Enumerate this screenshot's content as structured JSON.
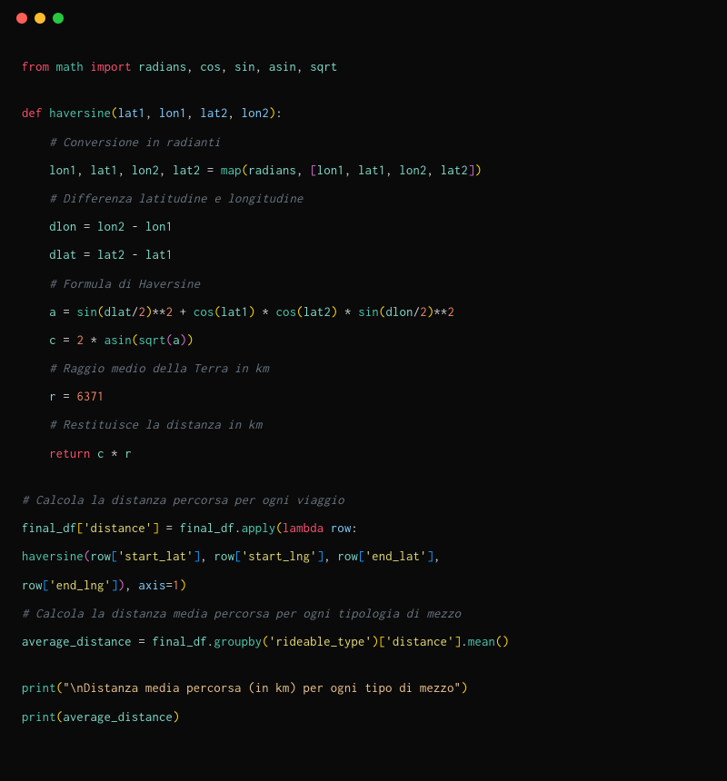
{
  "code": {
    "lines": [
      {
        "type": "code",
        "tokens": [
          {
            "cls": "kw-red",
            "t": "from"
          },
          {
            "cls": "white",
            "t": " "
          },
          {
            "cls": "fn-teal",
            "t": "math"
          },
          {
            "cls": "white",
            "t": " "
          },
          {
            "cls": "kw-red",
            "t": "import"
          },
          {
            "cls": "white",
            "t": " "
          },
          {
            "cls": "var-blue",
            "t": "radians"
          },
          {
            "cls": "punct",
            "t": ", "
          },
          {
            "cls": "var-blue",
            "t": "cos"
          },
          {
            "cls": "punct",
            "t": ", "
          },
          {
            "cls": "var-blue",
            "t": "sin"
          },
          {
            "cls": "punct",
            "t": ", "
          },
          {
            "cls": "var-blue",
            "t": "asin"
          },
          {
            "cls": "punct",
            "t": ", "
          },
          {
            "cls": "var-blue",
            "t": "sqrt"
          }
        ]
      },
      {
        "type": "blank"
      },
      {
        "type": "code",
        "tokens": [
          {
            "cls": "kw-red",
            "t": "def"
          },
          {
            "cls": "white",
            "t": " "
          },
          {
            "cls": "fn-teal",
            "t": "haversine"
          },
          {
            "cls": "paren",
            "t": "("
          },
          {
            "cls": "var-cyan",
            "t": "lat1"
          },
          {
            "cls": "punct",
            "t": ", "
          },
          {
            "cls": "var-cyan",
            "t": "lon1"
          },
          {
            "cls": "punct",
            "t": ", "
          },
          {
            "cls": "var-cyan",
            "t": "lat2"
          },
          {
            "cls": "punct",
            "t": ", "
          },
          {
            "cls": "var-cyan",
            "t": "lon2"
          },
          {
            "cls": "paren",
            "t": ")"
          },
          {
            "cls": "punct",
            "t": ":"
          }
        ]
      },
      {
        "type": "code",
        "tokens": [
          {
            "cls": "white",
            "t": "    "
          },
          {
            "cls": "comment",
            "t": "# Conversione in radianti"
          }
        ]
      },
      {
        "type": "code",
        "tokens": [
          {
            "cls": "white",
            "t": "    "
          },
          {
            "cls": "var-blue",
            "t": "lon1"
          },
          {
            "cls": "punct",
            "t": ", "
          },
          {
            "cls": "var-blue",
            "t": "lat1"
          },
          {
            "cls": "punct",
            "t": ", "
          },
          {
            "cls": "var-blue",
            "t": "lon2"
          },
          {
            "cls": "punct",
            "t": ", "
          },
          {
            "cls": "var-blue",
            "t": "lat2"
          },
          {
            "cls": "white",
            "t": " "
          },
          {
            "cls": "op",
            "t": "="
          },
          {
            "cls": "white",
            "t": " "
          },
          {
            "cls": "fn-teal",
            "t": "map"
          },
          {
            "cls": "paren",
            "t": "("
          },
          {
            "cls": "var-blue",
            "t": "radians"
          },
          {
            "cls": "punct",
            "t": ", "
          },
          {
            "cls": "paren2",
            "t": "["
          },
          {
            "cls": "var-blue",
            "t": "lon1"
          },
          {
            "cls": "punct",
            "t": ", "
          },
          {
            "cls": "var-blue",
            "t": "lat1"
          },
          {
            "cls": "punct",
            "t": ", "
          },
          {
            "cls": "var-blue",
            "t": "lon2"
          },
          {
            "cls": "punct",
            "t": ", "
          },
          {
            "cls": "var-blue",
            "t": "lat2"
          },
          {
            "cls": "paren2",
            "t": "]"
          },
          {
            "cls": "paren",
            "t": ")"
          }
        ]
      },
      {
        "type": "code",
        "tokens": [
          {
            "cls": "white",
            "t": "    "
          },
          {
            "cls": "comment",
            "t": "# Differenza latitudine e longitudine"
          }
        ]
      },
      {
        "type": "code",
        "tokens": [
          {
            "cls": "white",
            "t": "    "
          },
          {
            "cls": "var-blue",
            "t": "dlon"
          },
          {
            "cls": "white",
            "t": " "
          },
          {
            "cls": "op",
            "t": "="
          },
          {
            "cls": "white",
            "t": " "
          },
          {
            "cls": "var-blue",
            "t": "lon2"
          },
          {
            "cls": "white",
            "t": " "
          },
          {
            "cls": "op",
            "t": "-"
          },
          {
            "cls": "white",
            "t": " "
          },
          {
            "cls": "var-blue",
            "t": "lon1"
          }
        ]
      },
      {
        "type": "code",
        "tokens": [
          {
            "cls": "white",
            "t": "    "
          },
          {
            "cls": "var-blue",
            "t": "dlat"
          },
          {
            "cls": "white",
            "t": " "
          },
          {
            "cls": "op",
            "t": "="
          },
          {
            "cls": "white",
            "t": " "
          },
          {
            "cls": "var-blue",
            "t": "lat2"
          },
          {
            "cls": "white",
            "t": " "
          },
          {
            "cls": "op",
            "t": "-"
          },
          {
            "cls": "white",
            "t": " "
          },
          {
            "cls": "var-blue",
            "t": "lat1"
          }
        ]
      },
      {
        "type": "code",
        "tokens": [
          {
            "cls": "white",
            "t": "    "
          },
          {
            "cls": "comment",
            "t": "# Formula di Haversine"
          }
        ]
      },
      {
        "type": "code",
        "tokens": [
          {
            "cls": "white",
            "t": "    "
          },
          {
            "cls": "var-blue",
            "t": "a"
          },
          {
            "cls": "white",
            "t": " "
          },
          {
            "cls": "op",
            "t": "="
          },
          {
            "cls": "white",
            "t": " "
          },
          {
            "cls": "fn-teal",
            "t": "sin"
          },
          {
            "cls": "paren",
            "t": "("
          },
          {
            "cls": "var-blue",
            "t": "dlat"
          },
          {
            "cls": "op",
            "t": "/"
          },
          {
            "cls": "number",
            "t": "2"
          },
          {
            "cls": "paren",
            "t": ")"
          },
          {
            "cls": "op",
            "t": "**"
          },
          {
            "cls": "number",
            "t": "2"
          },
          {
            "cls": "white",
            "t": " "
          },
          {
            "cls": "op",
            "t": "+"
          },
          {
            "cls": "white",
            "t": " "
          },
          {
            "cls": "fn-teal",
            "t": "cos"
          },
          {
            "cls": "paren",
            "t": "("
          },
          {
            "cls": "var-blue",
            "t": "lat1"
          },
          {
            "cls": "paren",
            "t": ")"
          },
          {
            "cls": "white",
            "t": " "
          },
          {
            "cls": "op",
            "t": "*"
          },
          {
            "cls": "white",
            "t": " "
          },
          {
            "cls": "fn-teal",
            "t": "cos"
          },
          {
            "cls": "paren",
            "t": "("
          },
          {
            "cls": "var-blue",
            "t": "lat2"
          },
          {
            "cls": "paren",
            "t": ")"
          },
          {
            "cls": "white",
            "t": " "
          },
          {
            "cls": "op",
            "t": "*"
          },
          {
            "cls": "white",
            "t": " "
          },
          {
            "cls": "fn-teal",
            "t": "sin"
          },
          {
            "cls": "paren",
            "t": "("
          },
          {
            "cls": "var-blue",
            "t": "dlon"
          },
          {
            "cls": "op",
            "t": "/"
          },
          {
            "cls": "number",
            "t": "2"
          },
          {
            "cls": "paren",
            "t": ")"
          },
          {
            "cls": "op",
            "t": "**"
          },
          {
            "cls": "number",
            "t": "2"
          }
        ]
      },
      {
        "type": "code",
        "tokens": [
          {
            "cls": "white",
            "t": "    "
          },
          {
            "cls": "var-blue",
            "t": "c"
          },
          {
            "cls": "white",
            "t": " "
          },
          {
            "cls": "op",
            "t": "="
          },
          {
            "cls": "white",
            "t": " "
          },
          {
            "cls": "number",
            "t": "2"
          },
          {
            "cls": "white",
            "t": " "
          },
          {
            "cls": "op",
            "t": "*"
          },
          {
            "cls": "white",
            "t": " "
          },
          {
            "cls": "fn-teal",
            "t": "asin"
          },
          {
            "cls": "paren",
            "t": "("
          },
          {
            "cls": "fn-teal",
            "t": "sqrt"
          },
          {
            "cls": "paren2",
            "t": "("
          },
          {
            "cls": "var-blue",
            "t": "a"
          },
          {
            "cls": "paren2",
            "t": ")"
          },
          {
            "cls": "paren",
            "t": ")"
          }
        ]
      },
      {
        "type": "code",
        "tokens": [
          {
            "cls": "white",
            "t": "    "
          },
          {
            "cls": "comment",
            "t": "# Raggio medio della Terra in km"
          }
        ]
      },
      {
        "type": "code",
        "tokens": [
          {
            "cls": "white",
            "t": "    "
          },
          {
            "cls": "var-blue",
            "t": "r"
          },
          {
            "cls": "white",
            "t": " "
          },
          {
            "cls": "op",
            "t": "="
          },
          {
            "cls": "white",
            "t": " "
          },
          {
            "cls": "number",
            "t": "6371"
          }
        ]
      },
      {
        "type": "code",
        "tokens": [
          {
            "cls": "white",
            "t": "    "
          },
          {
            "cls": "comment",
            "t": "# Restituisce la distanza in km"
          }
        ]
      },
      {
        "type": "code",
        "tokens": [
          {
            "cls": "white",
            "t": "    "
          },
          {
            "cls": "kw-red",
            "t": "return"
          },
          {
            "cls": "white",
            "t": " "
          },
          {
            "cls": "var-blue",
            "t": "c"
          },
          {
            "cls": "white",
            "t": " "
          },
          {
            "cls": "op",
            "t": "*"
          },
          {
            "cls": "white",
            "t": " "
          },
          {
            "cls": "var-blue",
            "t": "r"
          }
        ]
      },
      {
        "type": "blank"
      },
      {
        "type": "code",
        "tokens": [
          {
            "cls": "comment",
            "t": "# Calcola la distanza percorsa per ogni viaggio"
          }
        ]
      },
      {
        "type": "code",
        "tokens": [
          {
            "cls": "var-blue",
            "t": "final_df"
          },
          {
            "cls": "paren",
            "t": "["
          },
          {
            "cls": "string",
            "t": "'distance'"
          },
          {
            "cls": "paren",
            "t": "]"
          },
          {
            "cls": "white",
            "t": " "
          },
          {
            "cls": "op",
            "t": "="
          },
          {
            "cls": "white",
            "t": " "
          },
          {
            "cls": "var-blue",
            "t": "final_df"
          },
          {
            "cls": "punct",
            "t": "."
          },
          {
            "cls": "fn-teal",
            "t": "apply"
          },
          {
            "cls": "paren",
            "t": "("
          },
          {
            "cls": "kw-red",
            "t": "lambda"
          },
          {
            "cls": "white",
            "t": " "
          },
          {
            "cls": "var-cyan",
            "t": "row"
          },
          {
            "cls": "punct",
            "t": ":"
          }
        ]
      },
      {
        "type": "code",
        "tokens": [
          {
            "cls": "fn-teal",
            "t": "haversine"
          },
          {
            "cls": "paren2",
            "t": "("
          },
          {
            "cls": "var-blue",
            "t": "row"
          },
          {
            "cls": "paren3",
            "t": "["
          },
          {
            "cls": "string",
            "t": "'start_lat'"
          },
          {
            "cls": "paren3",
            "t": "]"
          },
          {
            "cls": "punct",
            "t": ", "
          },
          {
            "cls": "var-blue",
            "t": "row"
          },
          {
            "cls": "paren3",
            "t": "["
          },
          {
            "cls": "string",
            "t": "'start_lng'"
          },
          {
            "cls": "paren3",
            "t": "]"
          },
          {
            "cls": "punct",
            "t": ", "
          },
          {
            "cls": "var-blue",
            "t": "row"
          },
          {
            "cls": "paren3",
            "t": "["
          },
          {
            "cls": "string",
            "t": "'end_lat'"
          },
          {
            "cls": "paren3",
            "t": "]"
          },
          {
            "cls": "punct",
            "t": ","
          }
        ]
      },
      {
        "type": "code",
        "tokens": [
          {
            "cls": "var-blue",
            "t": "row"
          },
          {
            "cls": "paren3",
            "t": "["
          },
          {
            "cls": "string",
            "t": "'end_lng'"
          },
          {
            "cls": "paren3",
            "t": "]"
          },
          {
            "cls": "paren2",
            "t": ")"
          },
          {
            "cls": "punct",
            "t": ", "
          },
          {
            "cls": "var-cyan",
            "t": "axis"
          },
          {
            "cls": "op",
            "t": "="
          },
          {
            "cls": "number",
            "t": "1"
          },
          {
            "cls": "paren",
            "t": ")"
          }
        ]
      },
      {
        "type": "code",
        "tokens": [
          {
            "cls": "comment",
            "t": "# Calcola la distanza media percorsa per ogni tipologia di mezzo"
          }
        ]
      },
      {
        "type": "code",
        "tokens": [
          {
            "cls": "var-blue",
            "t": "average_distance"
          },
          {
            "cls": "white",
            "t": " "
          },
          {
            "cls": "op",
            "t": "="
          },
          {
            "cls": "white",
            "t": " "
          },
          {
            "cls": "var-blue",
            "t": "final_df"
          },
          {
            "cls": "punct",
            "t": "."
          },
          {
            "cls": "fn-teal",
            "t": "groupby"
          },
          {
            "cls": "paren",
            "t": "("
          },
          {
            "cls": "string",
            "t": "'rideable_type'"
          },
          {
            "cls": "paren",
            "t": ")"
          },
          {
            "cls": "paren",
            "t": "["
          },
          {
            "cls": "string",
            "t": "'distance'"
          },
          {
            "cls": "paren",
            "t": "]"
          },
          {
            "cls": "punct",
            "t": "."
          },
          {
            "cls": "fn-teal",
            "t": "mean"
          },
          {
            "cls": "paren",
            "t": "("
          },
          {
            "cls": "paren",
            "t": ")"
          }
        ]
      },
      {
        "type": "blank"
      },
      {
        "type": "code",
        "tokens": [
          {
            "cls": "fn-teal",
            "t": "print"
          },
          {
            "cls": "paren",
            "t": "("
          },
          {
            "cls": "string-orange",
            "t": "\"\\nDistanza media percorsa (in km) per ogni tipo di mezzo\""
          },
          {
            "cls": "paren",
            "t": ")"
          }
        ]
      },
      {
        "type": "code",
        "tokens": [
          {
            "cls": "fn-teal",
            "t": "print"
          },
          {
            "cls": "paren",
            "t": "("
          },
          {
            "cls": "var-blue",
            "t": "average_distance"
          },
          {
            "cls": "paren",
            "t": ")"
          }
        ]
      }
    ]
  }
}
